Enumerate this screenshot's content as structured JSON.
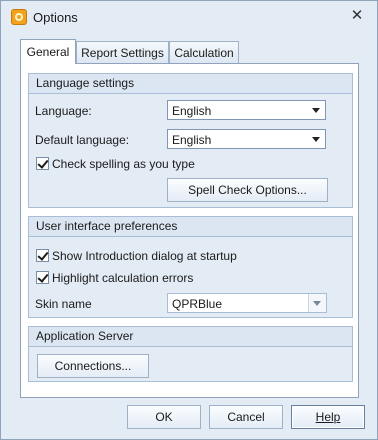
{
  "window": {
    "title": "Options",
    "close_glyph": "✕"
  },
  "tabs": [
    {
      "label": "General",
      "active": true
    },
    {
      "label": "Report Settings",
      "active": false
    },
    {
      "label": "Calculation",
      "active": false
    }
  ],
  "language_settings": {
    "header": "Language settings",
    "language_label": "Language:",
    "language_value": "English",
    "default_language_label": "Default language:",
    "default_language_value": "English",
    "spell_check_label": "Check spelling as you type",
    "spell_check_checked": true,
    "spell_check_options_button": "Spell Check Options..."
  },
  "ui_preferences": {
    "header": "User interface preferences",
    "show_intro_label": "Show Introduction dialog at startup",
    "show_intro_checked": true,
    "highlight_errors_label": "Highlight calculation errors",
    "highlight_errors_checked": true,
    "skin_name_label": "Skin name",
    "skin_name_value": "QPRBlue"
  },
  "application_server": {
    "header": "Application Server",
    "connections_button": "Connections..."
  },
  "footer": {
    "ok_label": "OK",
    "cancel_label": "Cancel",
    "help_label": "Help"
  },
  "colors": {
    "window_bg": "#e3ebf5",
    "panel_border": "#8fa3bd",
    "app_icon": "#f3a21b"
  },
  "icons": [
    "app-icon",
    "close-icon",
    "chevron-down-icon",
    "checkmark-icon"
  ]
}
